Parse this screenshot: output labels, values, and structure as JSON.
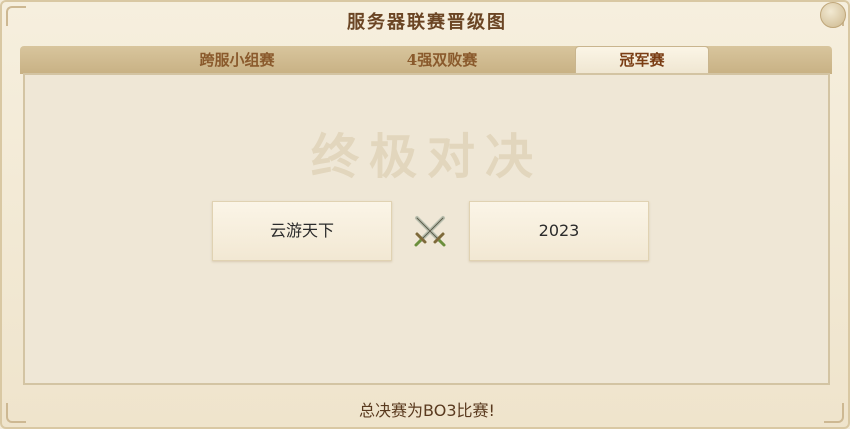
{
  "window": {
    "title": "服务器联赛晋级图"
  },
  "tabs": [
    {
      "label": "跨服小组赛",
      "active": false
    },
    {
      "label": "4强双败赛",
      "active": false
    },
    {
      "label": "冠军赛",
      "active": true
    }
  ],
  "match": {
    "heading": "终极对决",
    "team_left": "云游天下",
    "team_right": "2023",
    "vs_icon": "crossed-swords-icon"
  },
  "footer": {
    "note": "总决赛为BO3比赛!"
  },
  "colors": {
    "title": "#6b4524",
    "tab_text": "#8a5a2c",
    "background": "#efe7d6"
  }
}
